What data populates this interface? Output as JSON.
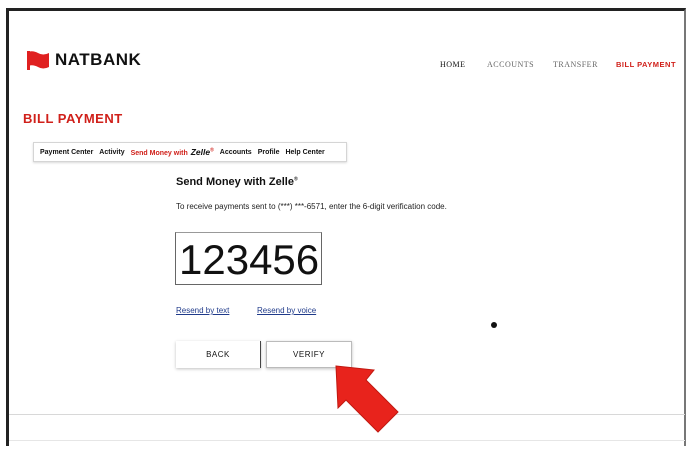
{
  "brand": {
    "name": "NATBANK",
    "color": "#e02020"
  },
  "top_nav": {
    "home": "HOME",
    "accounts": "ACCOUNTS",
    "transfer": "TRANSFER",
    "bill_payment": "BILL PAYMENT"
  },
  "page_title": "BILL PAYMENT",
  "sub_nav": {
    "payment_center": "Payment Center",
    "activity": "Activity",
    "send_money": "Send Money with",
    "zelle": "Zelle",
    "accounts": "Accounts",
    "profile": "Profile",
    "help_center": "Help Center"
  },
  "section": {
    "title": "Send Money with Zelle",
    "instructions": "To receive payments sent to (***) ***-6571, enter the 6-digit verification code."
  },
  "code_input": {
    "value": "123456"
  },
  "links": {
    "resend_text": "Resend by text",
    "resend_voice": "Resend by voice"
  },
  "buttons": {
    "back": "BACK",
    "verify": "VERIFY"
  },
  "colors": {
    "accent": "#d0201a",
    "link": "#1f3a8a",
    "arrow": "#e8231c"
  },
  "icons": {
    "logo": "flag-logo-icon",
    "pointer": "red-arrow-icon",
    "bullet": "dot-icon"
  }
}
